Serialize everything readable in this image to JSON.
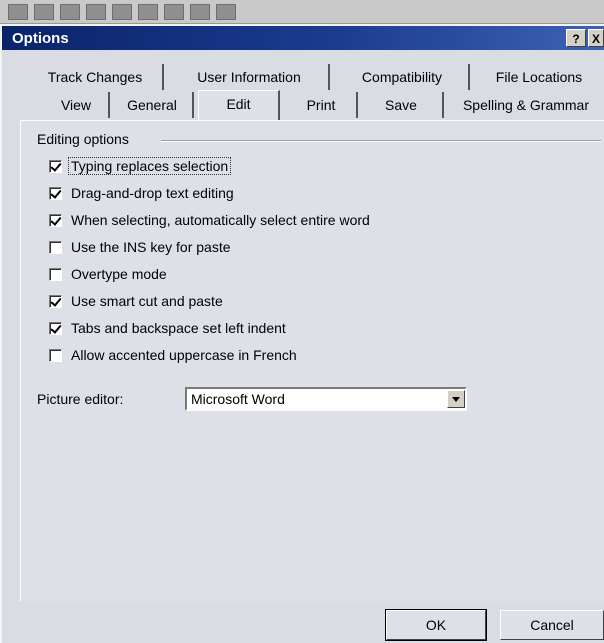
{
  "dialog": {
    "title": "Options",
    "help_label": "?",
    "close_label": "X"
  },
  "tabs_back": [
    {
      "label": "Track Changes"
    },
    {
      "label": "User Information"
    },
    {
      "label": "Compatibility"
    },
    {
      "label": "File Locations"
    }
  ],
  "tabs_front": [
    {
      "label": "View"
    },
    {
      "label": "General"
    },
    {
      "label": "Edit"
    },
    {
      "label": "Print"
    },
    {
      "label": "Save"
    },
    {
      "label": "Spelling & Grammar"
    }
  ],
  "active_tab": "Edit",
  "editing": {
    "group_label": "Editing options",
    "options": [
      {
        "label": "Typing replaces selection",
        "checked": true
      },
      {
        "label": "Drag-and-drop text editing",
        "checked": true
      },
      {
        "label": "When selecting, automatically select entire word",
        "checked": true
      },
      {
        "label": "Use the INS key for paste",
        "checked": false
      },
      {
        "label": "Overtype mode",
        "checked": false
      },
      {
        "label": "Use smart cut and paste",
        "checked": true
      },
      {
        "label": "Tabs and backspace set left indent",
        "checked": true
      },
      {
        "label": "Allow accented uppercase in French",
        "checked": false
      }
    ],
    "picture_editor_label": "Picture editor:",
    "picture_editor_value": "Microsoft Word"
  },
  "buttons": {
    "ok": "OK",
    "cancel": "Cancel"
  }
}
